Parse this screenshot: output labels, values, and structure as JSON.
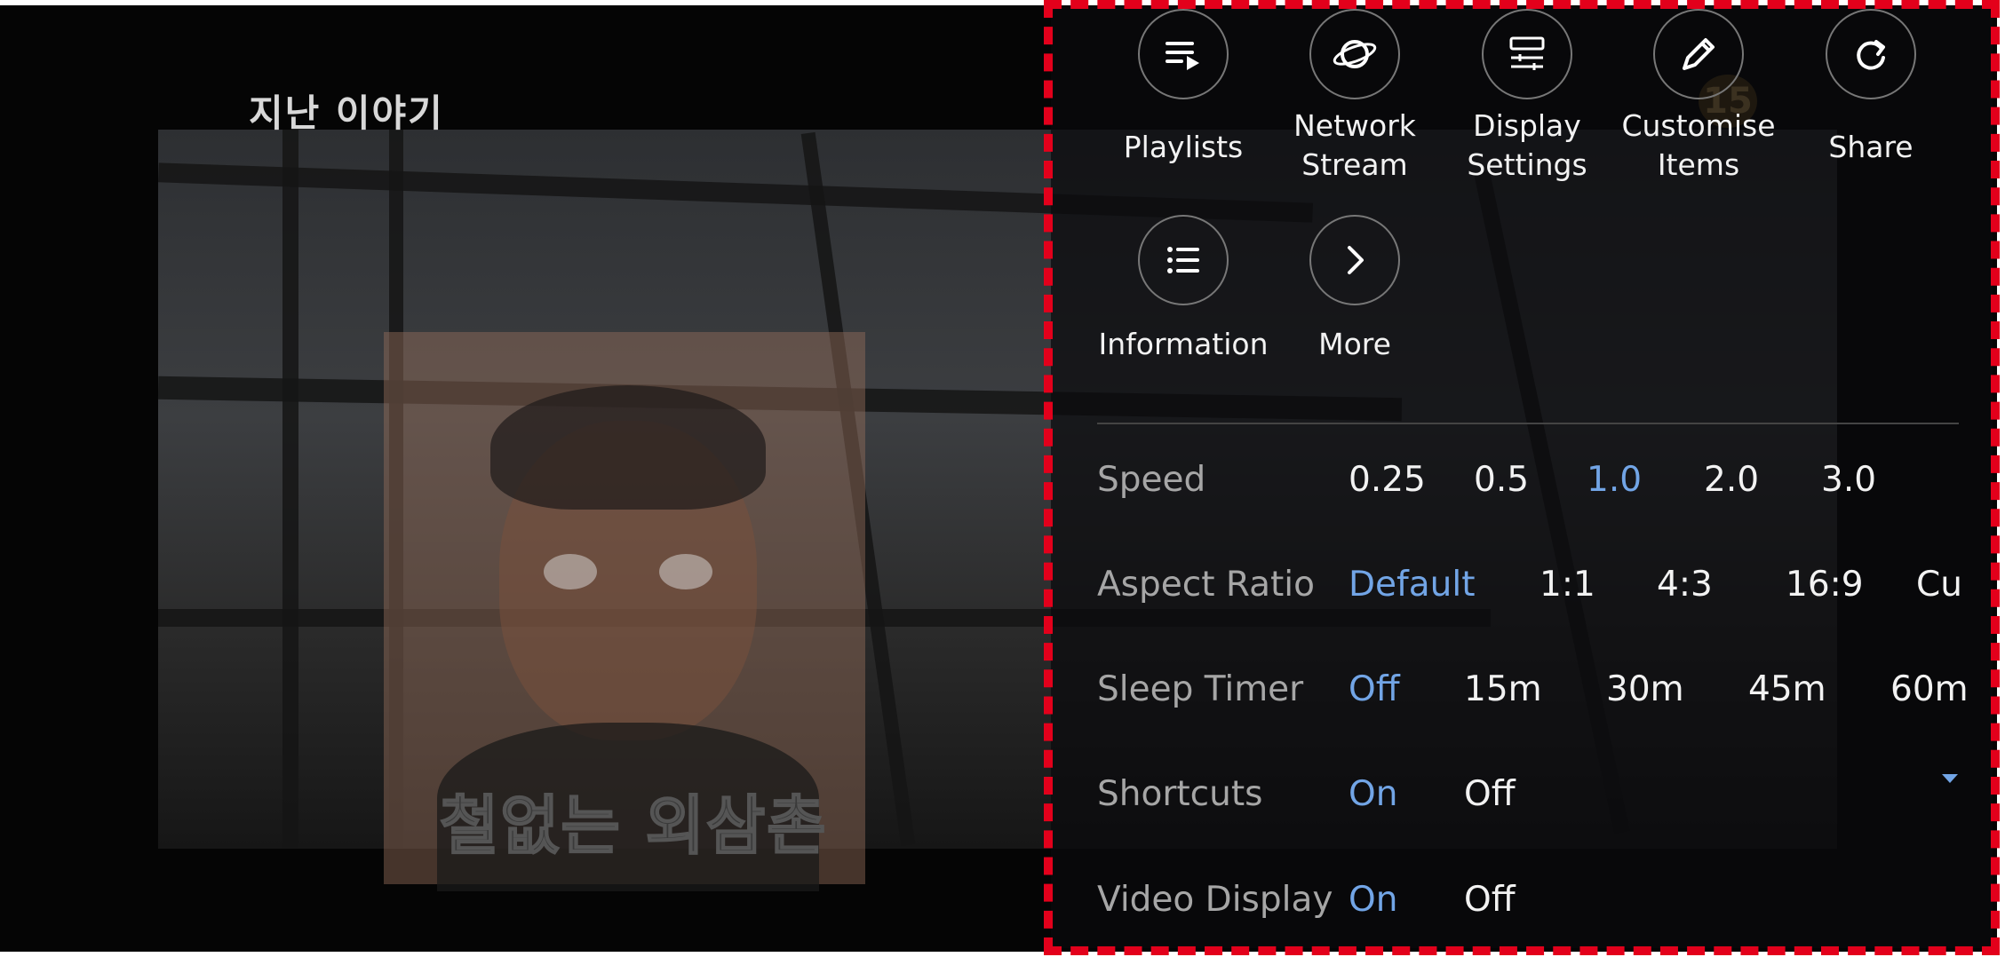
{
  "video": {
    "title_overlay": "지난 이야기",
    "subtitle": "철없는 외삼촌",
    "rating_badge": "15"
  },
  "menu": {
    "icons": [
      {
        "label": "Playlists",
        "icon": "playlist-icon"
      },
      {
        "label": "Network\nStream",
        "icon": "network-stream-icon"
      },
      {
        "label": "Display\nSettings",
        "icon": "display-settings-icon"
      },
      {
        "label": "Customise\nItems",
        "icon": "pencil-icon"
      },
      {
        "label": "Share",
        "icon": "share-icon"
      },
      {
        "label": "Information",
        "icon": "list-icon"
      },
      {
        "label": "More",
        "icon": "chevron-right-icon"
      }
    ],
    "speed": {
      "label": "Speed",
      "options": [
        "0.25",
        "0.5",
        "1.0",
        "2.0",
        "3.0"
      ],
      "selected": "1.0"
    },
    "aspect_ratio": {
      "label": "Aspect Ratio",
      "options": [
        "Default",
        "1:1",
        "4:3",
        "16:9",
        "Cu"
      ],
      "selected": "Default"
    },
    "sleep_timer": {
      "label": "Sleep Timer",
      "options": [
        "Off",
        "15m",
        "30m",
        "45m",
        "60m"
      ],
      "selected": "Off"
    },
    "shortcuts": {
      "label": "Shortcuts",
      "options": [
        "On",
        "Off"
      ],
      "selected": "On"
    },
    "video_display": {
      "label": "Video Display",
      "options": [
        "On",
        "Off"
      ],
      "selected": "On"
    }
  },
  "colors": {
    "accent": "#72a5e6",
    "highlight_border": "#e3001b"
  }
}
